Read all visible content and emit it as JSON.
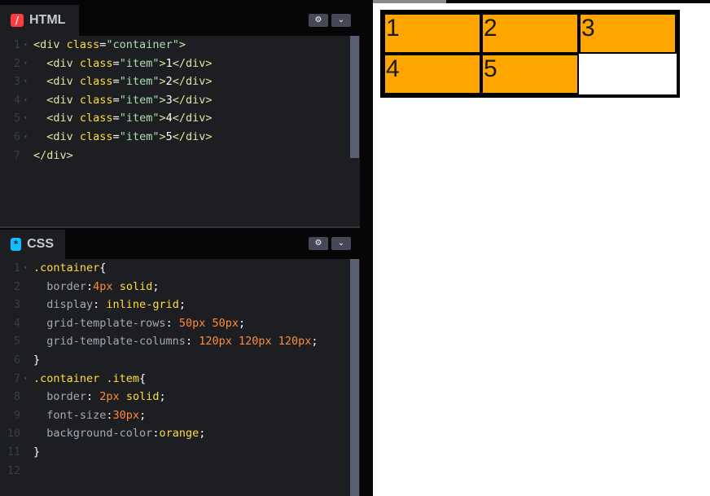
{
  "html_pane": {
    "tab_label": "HTML",
    "badge": "/",
    "lines": [
      {
        "n": "1",
        "fold": "▾",
        "parts": [
          [
            "t-tag",
            "<div "
          ],
          [
            "t-attr",
            "class"
          ],
          [
            "t-punc",
            "="
          ],
          [
            "t-str",
            "\"container\""
          ],
          [
            "t-tag",
            ">"
          ]
        ]
      },
      {
        "n": "2",
        "fold": "▾",
        "parts": [
          [
            "t-tag",
            "  <div "
          ],
          [
            "t-attr",
            "class"
          ],
          [
            "t-punc",
            "="
          ],
          [
            "t-str",
            "\"item\""
          ],
          [
            "t-tag",
            ">"
          ],
          [
            "t-plain",
            "1"
          ],
          [
            "t-tag",
            "</div>"
          ]
        ]
      },
      {
        "n": "3",
        "fold": "▾",
        "parts": [
          [
            "t-tag",
            "  <div "
          ],
          [
            "t-attr",
            "class"
          ],
          [
            "t-punc",
            "="
          ],
          [
            "t-str",
            "\"item\""
          ],
          [
            "t-tag",
            ">"
          ],
          [
            "t-plain",
            "2"
          ],
          [
            "t-tag",
            "</div>"
          ]
        ]
      },
      {
        "n": "4",
        "fold": "▾",
        "parts": [
          [
            "t-tag",
            "  <div "
          ],
          [
            "t-attr",
            "class"
          ],
          [
            "t-punc",
            "="
          ],
          [
            "t-str",
            "\"item\""
          ],
          [
            "t-tag",
            ">"
          ],
          [
            "t-plain",
            "3"
          ],
          [
            "t-tag",
            "</div>"
          ]
        ]
      },
      {
        "n": "5",
        "fold": "▾",
        "parts": [
          [
            "t-tag",
            "  <div "
          ],
          [
            "t-attr",
            "class"
          ],
          [
            "t-punc",
            "="
          ],
          [
            "t-str",
            "\"item\""
          ],
          [
            "t-tag",
            ">"
          ],
          [
            "t-plain",
            "4"
          ],
          [
            "t-tag",
            "</div>"
          ]
        ]
      },
      {
        "n": "6",
        "fold": "▾",
        "parts": [
          [
            "t-tag",
            "  <div "
          ],
          [
            "t-attr",
            "class"
          ],
          [
            "t-punc",
            "="
          ],
          [
            "t-str",
            "\"item\""
          ],
          [
            "t-tag",
            ">"
          ],
          [
            "t-plain",
            "5"
          ],
          [
            "t-tag",
            "</div>"
          ]
        ]
      },
      {
        "n": "7",
        "fold": "",
        "parts": [
          [
            "t-tag",
            "</div>"
          ]
        ]
      }
    ]
  },
  "css_pane": {
    "tab_label": "CSS",
    "badge": "*",
    "lines": [
      {
        "n": "1",
        "fold": "▾",
        "parts": [
          [
            "t-sel",
            ".container"
          ],
          [
            "t-punc",
            "{"
          ]
        ]
      },
      {
        "n": "2",
        "fold": "",
        "parts": [
          [
            "t-prop",
            "  border"
          ],
          [
            "t-punc",
            ":"
          ],
          [
            "t-num",
            "4px"
          ],
          [
            "t-kw",
            " solid"
          ],
          [
            "t-punc",
            ";"
          ]
        ]
      },
      {
        "n": "3",
        "fold": "",
        "parts": [
          [
            "t-prop",
            "  display"
          ],
          [
            "t-punc",
            ": "
          ],
          [
            "t-kw",
            "inline-grid"
          ],
          [
            "t-punc",
            ";"
          ]
        ]
      },
      {
        "n": "4",
        "fold": "",
        "parts": [
          [
            "t-prop",
            "  grid-template-rows"
          ],
          [
            "t-punc",
            ": "
          ],
          [
            "t-num",
            "50px 50px"
          ],
          [
            "t-punc",
            ";"
          ]
        ]
      },
      {
        "n": "5",
        "fold": "",
        "parts": [
          [
            "t-prop",
            "  grid-template-columns"
          ],
          [
            "t-punc",
            ": "
          ],
          [
            "t-num",
            "120px 120px 120px"
          ],
          [
            "t-punc",
            ";"
          ]
        ]
      },
      {
        "n": "6",
        "fold": "",
        "parts": [
          [
            "t-punc",
            "}"
          ]
        ]
      },
      {
        "n": "7",
        "fold": "▾",
        "parts": [
          [
            "t-sel",
            ".container .item"
          ],
          [
            "t-punc",
            "{"
          ]
        ]
      },
      {
        "n": "8",
        "fold": "",
        "parts": [
          [
            "t-prop",
            "  border"
          ],
          [
            "t-punc",
            ": "
          ],
          [
            "t-num",
            "2px"
          ],
          [
            "t-kw",
            " solid"
          ],
          [
            "t-punc",
            ";"
          ]
        ]
      },
      {
        "n": "9",
        "fold": "",
        "parts": [
          [
            "t-prop",
            "  font-size"
          ],
          [
            "t-punc",
            ":"
          ],
          [
            "t-num",
            "30px"
          ],
          [
            "t-punc",
            ";"
          ]
        ]
      },
      {
        "n": "10",
        "fold": "",
        "parts": [
          [
            "t-prop",
            "  background-color"
          ],
          [
            "t-punc",
            ":"
          ],
          [
            "t-kw",
            "orange"
          ],
          [
            "t-punc",
            ";"
          ]
        ]
      },
      {
        "n": "11",
        "fold": "",
        "parts": [
          [
            "t-punc",
            "}"
          ]
        ]
      },
      {
        "n": "12",
        "fold": "",
        "parts": []
      }
    ]
  },
  "pane_buttons": {
    "settings_icon": "gear-icon",
    "settings_glyph": "⚙",
    "collapse_icon": "chevron-down-icon",
    "collapse_glyph": "⌄"
  },
  "preview": {
    "items": [
      "1",
      "2",
      "3",
      "4",
      "5"
    ],
    "item_color": "#ffa500",
    "border_color": "#000000"
  }
}
